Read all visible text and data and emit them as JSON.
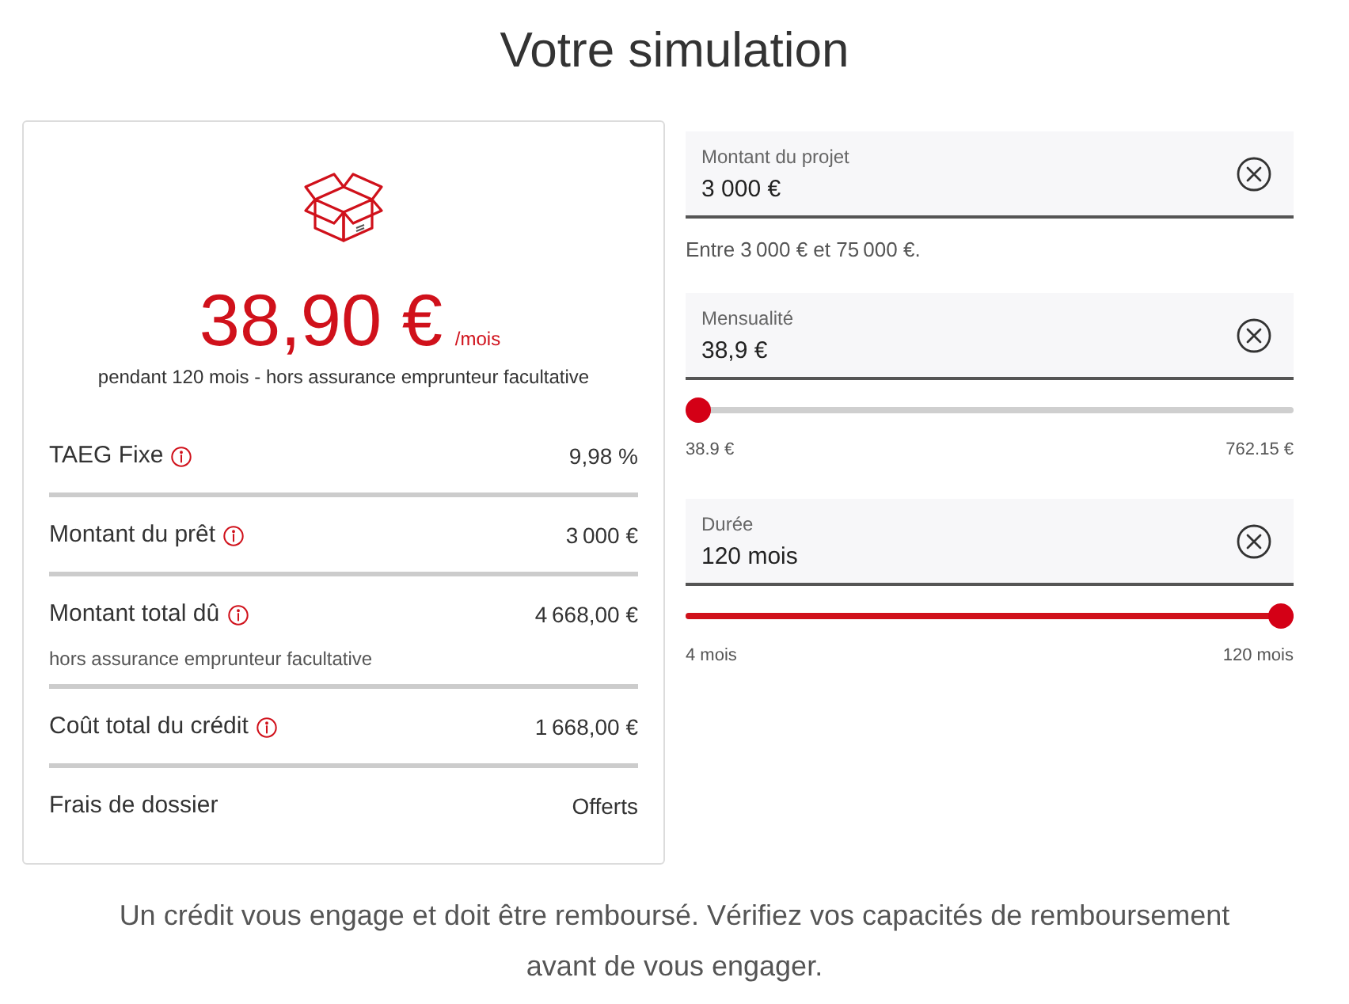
{
  "title": "Votre simulation",
  "summary": {
    "amount": "38,90 €",
    "unit": "/mois",
    "subtitle": "pendant 120 mois - hors assurance emprunteur facultative",
    "rows": [
      {
        "label": "TAEG Fixe",
        "info": true,
        "value": "9,98 %"
      },
      {
        "label": "Montant du prêt",
        "info": true,
        "value": "3 000 €"
      },
      {
        "label": "Montant total dû",
        "info": true,
        "value": "4 668,00 €",
        "note": "hors assurance emprunteur facultative"
      },
      {
        "label": "Coût total du crédit",
        "info": true,
        "value": "1 668,00 €"
      },
      {
        "label": "Frais de dossier",
        "info": false,
        "value": "Offerts"
      }
    ]
  },
  "fields": [
    {
      "label": "Montant du projet",
      "value": "3 000 €",
      "helper": "Entre 3 000 € et 75 000 €."
    },
    {
      "label": "Mensualité",
      "value": "38,9 €",
      "slider": {
        "level": 0,
        "min_label": "38.9 €",
        "max_label": "762.15 €"
      }
    },
    {
      "label": "Durée",
      "value": "120 mois",
      "slider": {
        "level": 1,
        "min_label": "4 mois",
        "max_label": "120 mois"
      }
    }
  ],
  "disclaimer": "Un crédit vous engage et doit être remboursé. Vérifiez vos capacités de remboursement avant de vous engager."
}
